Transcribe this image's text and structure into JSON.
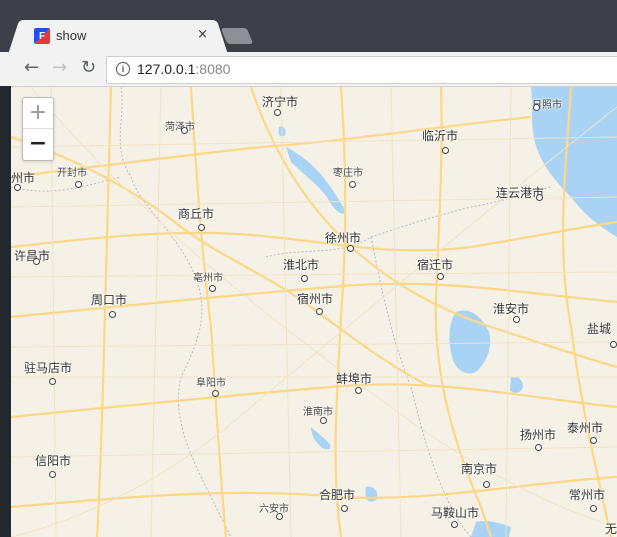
{
  "browser": {
    "tab_title": "show",
    "tab_close": "×",
    "favicon_label": "F",
    "url_host": "127.0.0.1",
    "url_port": ":8080",
    "back_icon": "←",
    "forward_icon": "→",
    "reload_icon": "↻",
    "info_icon": "i"
  },
  "map": {
    "zoom_in": "+",
    "zoom_out": "−",
    "cities": [
      {
        "name": "济宁市",
        "size": "large"
      },
      {
        "name": "日照市",
        "size": "small"
      },
      {
        "name": "菏泽市",
        "size": "small"
      },
      {
        "name": "临沂市",
        "size": "large"
      },
      {
        "name": "开封市",
        "size": "small"
      },
      {
        "name": "枣庄市",
        "size": "small"
      },
      {
        "name": "连云港市",
        "size": "large"
      },
      {
        "name": "商丘市",
        "size": "large"
      },
      {
        "name": "徐州市",
        "size": "large"
      },
      {
        "name": "许昌市",
        "size": "large"
      },
      {
        "name": "淮北市",
        "size": "large"
      },
      {
        "name": "宿迁市",
        "size": "large"
      },
      {
        "name": "亳州市",
        "size": "small"
      },
      {
        "name": "周口市",
        "size": "large"
      },
      {
        "name": "宿州市",
        "size": "large"
      },
      {
        "name": "淮安市",
        "size": "large"
      },
      {
        "name": "盐城",
        "size": "large"
      },
      {
        "name": "驻马店市",
        "size": "large"
      },
      {
        "name": "蚌埠市",
        "size": "large"
      },
      {
        "name": "阜阳市",
        "size": "small"
      },
      {
        "name": "淮南市",
        "size": "small"
      },
      {
        "name": "扬州市",
        "size": "large"
      },
      {
        "name": "泰州市",
        "size": "large"
      },
      {
        "name": "信阳市",
        "size": "large"
      },
      {
        "name": "南京市",
        "size": "large"
      },
      {
        "name": "常州市",
        "size": "large"
      },
      {
        "name": "六安市",
        "size": "small"
      },
      {
        "name": "合肥市",
        "size": "large"
      },
      {
        "name": "马鞍山市",
        "size": "large"
      },
      {
        "name": "无锡",
        "size": "large"
      },
      {
        "name": "州市",
        "size": "large"
      }
    ]
  }
}
